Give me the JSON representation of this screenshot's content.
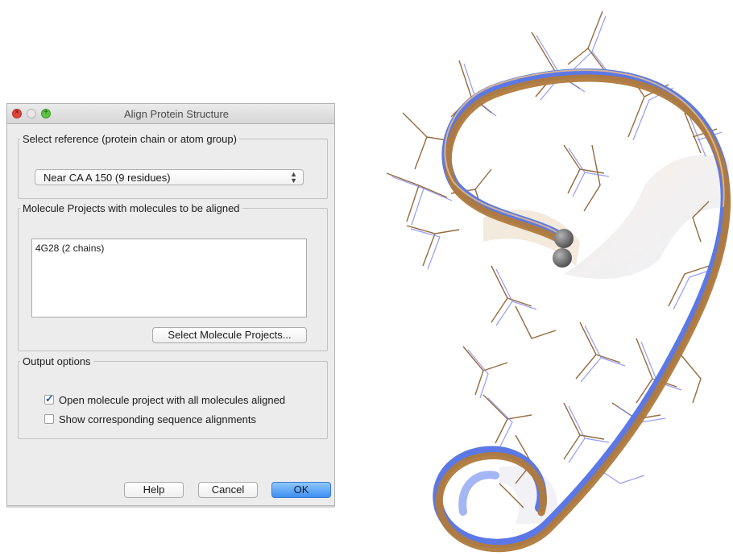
{
  "window": {
    "title": "Align Protein Structure"
  },
  "reference": {
    "legend": "Select reference (protein chain or atom group)",
    "selected": "Near CA A 150 (9 residues)"
  },
  "molecules": {
    "legend": "Molecule Projects with molecules to be aligned",
    "items": [
      "4G28 (2 chains)"
    ],
    "select_button": "Select Molecule Projects..."
  },
  "output": {
    "legend": "Output options",
    "options": [
      {
        "label": "Open molecule project with all molecules aligned",
        "checked": true
      },
      {
        "label": "Show corresponding sequence alignments",
        "checked": false
      }
    ]
  },
  "buttons": {
    "help": "Help",
    "cancel": "Cancel",
    "ok": "OK"
  },
  "colors": {
    "structure_blue": "#5b78e6",
    "structure_orange": "#b07a3c",
    "ok_button": "#4a95f2"
  }
}
